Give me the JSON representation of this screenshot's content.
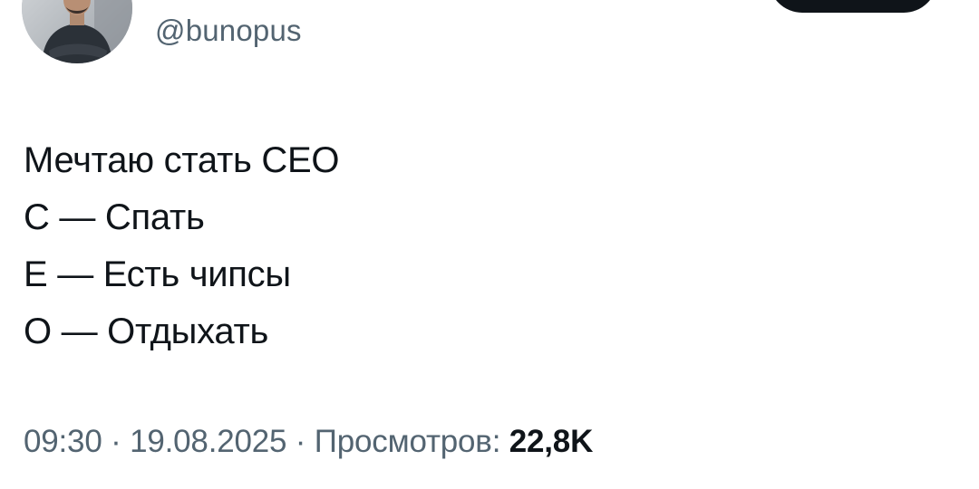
{
  "header": {
    "handle": "@bunopus",
    "display_name": "",
    "follow_button_label": "",
    "avatar_icon": "profile-photo-icon"
  },
  "tweet": {
    "lines": [
      "Мечтаю стать СЕО",
      "С — Спать",
      "Е — Есть чипсы",
      "О — Отдыхать"
    ]
  },
  "meta": {
    "time": "09:30",
    "separator": " · ",
    "date": "19.08.2025",
    "views_label": "Просмотров: ",
    "views_count": "22,8K"
  },
  "colors": {
    "primary_text": "#0f1419",
    "secondary_text": "#536471",
    "button_bg": "#0f1419",
    "background": "#ffffff"
  }
}
